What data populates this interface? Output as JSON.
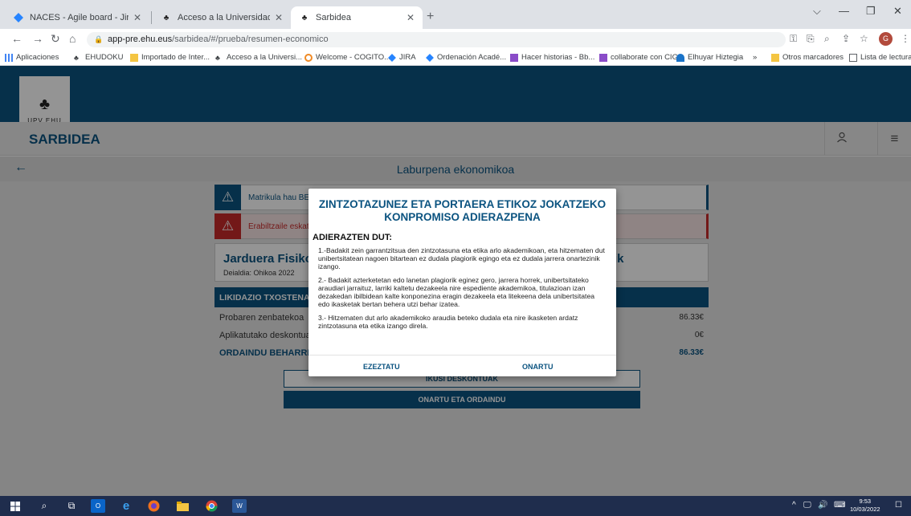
{
  "browser": {
    "tabs": [
      {
        "title": "NACES - Agile board - Jira",
        "icon": "jira-icon"
      },
      {
        "title": "Acceso a la Universidad - UPV/EHU",
        "icon": "upv-icon"
      },
      {
        "title": "Sarbidea",
        "icon": "upv-icon"
      }
    ],
    "new_tab": "+",
    "url_host": "app-pre.ehu.eus",
    "url_path": "/sarbidea/#/prueba/resumen-economico",
    "bookmarks": [
      {
        "label": "Aplicaciones",
        "icon": "apps-grid-icon"
      },
      {
        "label": "EHUDOKU",
        "icon": "upv-icon"
      },
      {
        "label": "Importado de Inter...",
        "icon": "folder-icon"
      },
      {
        "label": "Acceso a la Universi...",
        "icon": "upv-icon"
      },
      {
        "label": "Welcome - COGITO...",
        "icon": "cogito-icon"
      },
      {
        "label": "JIRA",
        "icon": "jira-icon"
      },
      {
        "label": "Ordenación Acadé...",
        "icon": "jira-icon"
      },
      {
        "label": "Hacer historias - Bb...",
        "icon": "bb-icon"
      },
      {
        "label": "collaborate con CIG",
        "icon": "bb-icon"
      },
      {
        "label": "Elhuyar Hiztegia",
        "icon": "elhuyar-icon"
      }
    ],
    "bookmarks_more": "»",
    "other_bookmarks": "Otros marcadores",
    "reading_list": "Lista de lectura",
    "profile_initial": "G"
  },
  "app": {
    "logo_text": "UPV  EHU",
    "name": "SARBIDEA",
    "page_title": "Laburpena ekonomikoa",
    "alerts": [
      {
        "text": "Matrikula hau BEH",
        "type": "info"
      },
      {
        "text": "Erabiltzaile eskatz",
        "type": "warning"
      }
    ],
    "card": {
      "title": "Jarduera Fisikoa",
      "title_tail": "ik",
      "subtitle": "Deialdia: Ohikoa 2022"
    },
    "liquidation": {
      "header": "LIKIDAZIO TXOSTENA",
      "rows": [
        {
          "label": "Probaren zenbatekoa",
          "value": "86.33€"
        },
        {
          "label": "Aplikatutako deskontuak",
          "value": "0€"
        },
        {
          "label": "ORDAINDU BEHARREKOA",
          "value": "86.33€",
          "total": true
        }
      ]
    },
    "buttons": {
      "discounts": "IKUSI DESKONTUAK",
      "accept_pay": "ONARTU ETA ORDAINDU"
    }
  },
  "modal": {
    "title": "ZINTZOTAZUNEZ ETA PORTAERA ETIKOZ JOKATZEKO KONPROMISO ADIERAZPENA",
    "heading": "ADIERAZTEN DUT:",
    "paragraphs": [
      "1.-Badakit zein garrantzitsua den zintzotasuna eta etika arlo akademikoan, eta hitzematen dut unibertsitatean nagoen bitartean ez dudala plagiorik egingo eta ez dudala jarrera onartezinik izango.",
      "2.- Badakit azterketetan edo lanetan plagiorik eginez gero, jarrera horrek, unibertsitateko araudiari jarraituz, larriki kaltetu dezakeela nire espediente akademikoa, titulazioan izan dezakedan ibilbidean kalte konponezina eragin dezakeela eta litekeena dela unibertsitatea edo ikasketak bertan behera utzi behar izatea.",
      "3.- Hitzematen dut arlo akademikoko araudia beteko dudala eta nire ikasketen ardatz zintzotasuna eta etika izango direla."
    ],
    "reject": "EZEZTATU",
    "accept": "ONARTU"
  },
  "taskbar": {
    "time": "9:53",
    "date": "10/03/2022"
  },
  "colors": {
    "brand": "#0b5380",
    "warning": "#c72a2a"
  }
}
